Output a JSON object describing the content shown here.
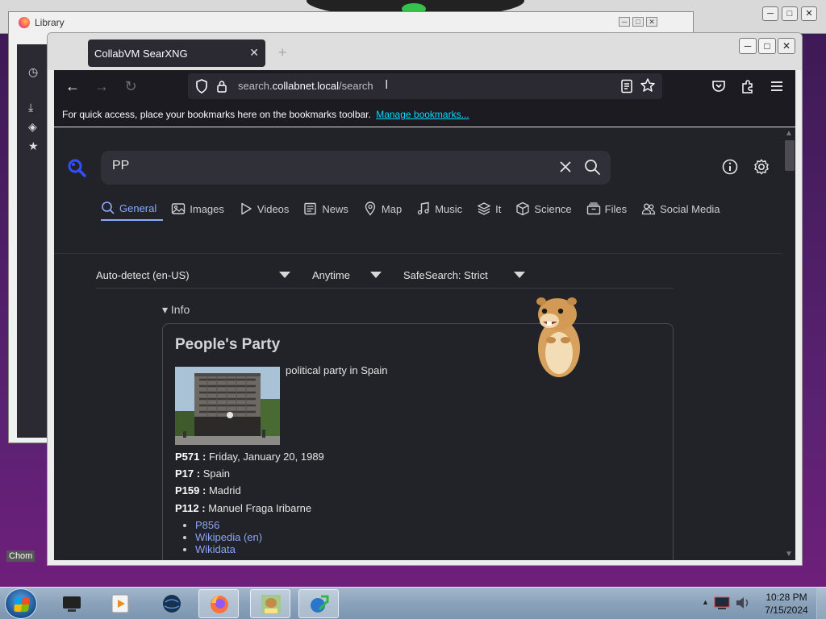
{
  "desktop": {
    "library_title": "Library",
    "chrome_label": "Chom"
  },
  "browser": {
    "tab_title": "CollabVM SearXNG",
    "url_host_prefix": "search.",
    "url_host": "collabnet.local",
    "url_path": "/search",
    "bookmarks_hint": "For quick access, place your bookmarks here on the bookmarks toolbar.",
    "manage_bookmarks": "Manage bookmarks..."
  },
  "search": {
    "query": "PP",
    "categories": [
      {
        "label": "General",
        "icon": "search-icon"
      },
      {
        "label": "Images",
        "icon": "image-icon"
      },
      {
        "label": "Videos",
        "icon": "play-icon"
      },
      {
        "label": "News",
        "icon": "newspaper-icon"
      },
      {
        "label": "Map",
        "icon": "map-pin-icon"
      },
      {
        "label": "Music",
        "icon": "music-icon"
      },
      {
        "label": "It",
        "icon": "layers-icon"
      },
      {
        "label": "Science",
        "icon": "cube-icon"
      },
      {
        "label": "Files",
        "icon": "files-icon"
      },
      {
        "label": "Social Media",
        "icon": "people-icon"
      }
    ],
    "active_category": "General",
    "filters": {
      "language": "Auto-detect (en-US)",
      "time": "Anytime",
      "safesearch": "SafeSearch: Strict"
    }
  },
  "infobox": {
    "toggle": "▾ Info",
    "title": "People's Party",
    "description": "political party in Spain",
    "attributes": [
      {
        "key": "P571 :",
        "value": "Friday, January 20, 1989"
      },
      {
        "key": "P17 :",
        "value": "Spain"
      },
      {
        "key": "P159 :",
        "value": "Madrid"
      },
      {
        "key": "P112 :",
        "value": "Manuel Fraga Iribarne"
      }
    ],
    "links": [
      "P856",
      "Wikipedia (en)",
      "Wikidata"
    ]
  },
  "taskbar": {
    "clock_time": "10:28 PM",
    "clock_date": "7/15/2024"
  },
  "colors": {
    "accent": "#8ba9ff",
    "link": "#8aa4f8",
    "page_bg": "#222328",
    "toolbar_bg": "#1c1b22"
  }
}
